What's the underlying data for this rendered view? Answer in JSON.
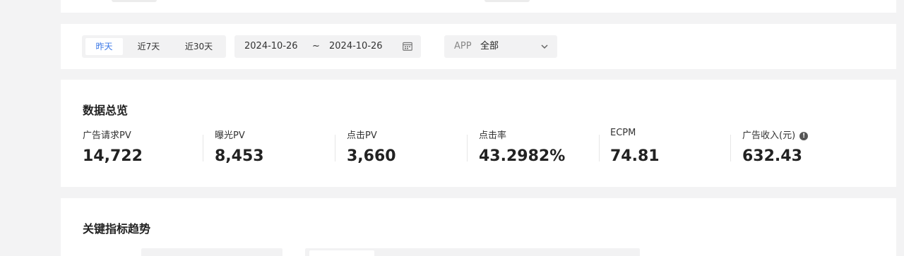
{
  "filters": {
    "tabs": [
      {
        "label": "昨天",
        "active": true
      },
      {
        "label": "近7天",
        "active": false
      },
      {
        "label": "近30天",
        "active": false
      }
    ],
    "date_range": {
      "start": "2024-10-26",
      "separator": "~",
      "end": "2024-10-26"
    },
    "app_select": {
      "label": "APP",
      "value": "全部"
    }
  },
  "overview": {
    "title": "数据总览",
    "metrics": [
      {
        "label": "广告请求PV",
        "value": "14,722"
      },
      {
        "label": "曝光PV",
        "value": "8,453"
      },
      {
        "label": "点击PV",
        "value": "3,660"
      },
      {
        "label": "点击率",
        "value": "43.2982%"
      },
      {
        "label": "ECPM",
        "value": "74.81"
      },
      {
        "label": "广告收入(元)",
        "value": "632.43"
      }
    ]
  },
  "trend": {
    "title": "关键指标趋势"
  },
  "colors": {
    "accent": "#3b78e7",
    "background": "#f3f3f4",
    "card": "#ffffff"
  }
}
